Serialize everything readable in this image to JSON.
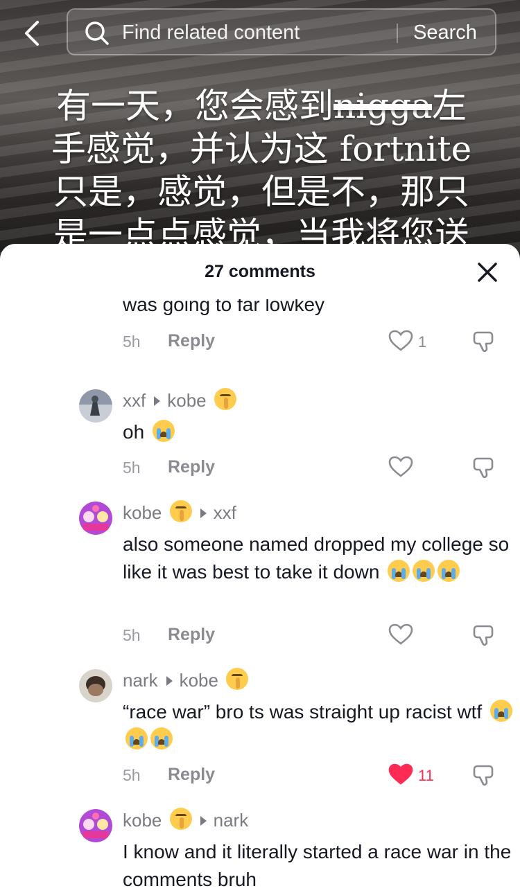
{
  "header": {
    "search_placeholder": "Find related content",
    "search_button": "Search"
  },
  "video": {
    "caption_lines": [
      "有一天，您会感到",
      "nigga",
      "左",
      "手感觉，并认为这 fortnite",
      "只是，感觉，但是不，那只",
      "是一点点感觉，当我将您送"
    ]
  },
  "sheet": {
    "title": "27 comments"
  },
  "comments": [
    {
      "author": "",
      "reply_to": "",
      "text": "was going to far lowkey",
      "time": "5h",
      "reply": "Reply",
      "likes": "1",
      "liked": false
    },
    {
      "author": "xxf",
      "reply_to": "kobe",
      "text": "oh",
      "time": "5h",
      "reply": "Reply",
      "likes": "",
      "liked": false
    },
    {
      "author": "kobe",
      "reply_to": "xxf",
      "text": "also someone named dropped my college so like it was best to take it down",
      "time": "5h",
      "reply": "Reply",
      "likes": "",
      "liked": false
    },
    {
      "author": "nark",
      "reply_to": "kobe",
      "text": "“race war” bro ts was straight up racist wtf",
      "time": "5h",
      "reply": "Reply",
      "likes": "11",
      "liked": true
    },
    {
      "author": "kobe",
      "reply_to": "nark",
      "text": "I know and it literally started a race war in the comments bruh",
      "time": "",
      "reply": "",
      "likes": "",
      "liked": false
    }
  ],
  "colors": {
    "like_red": "#fe2c55",
    "muted_text": "#7a7b82",
    "body_text": "#161823"
  }
}
